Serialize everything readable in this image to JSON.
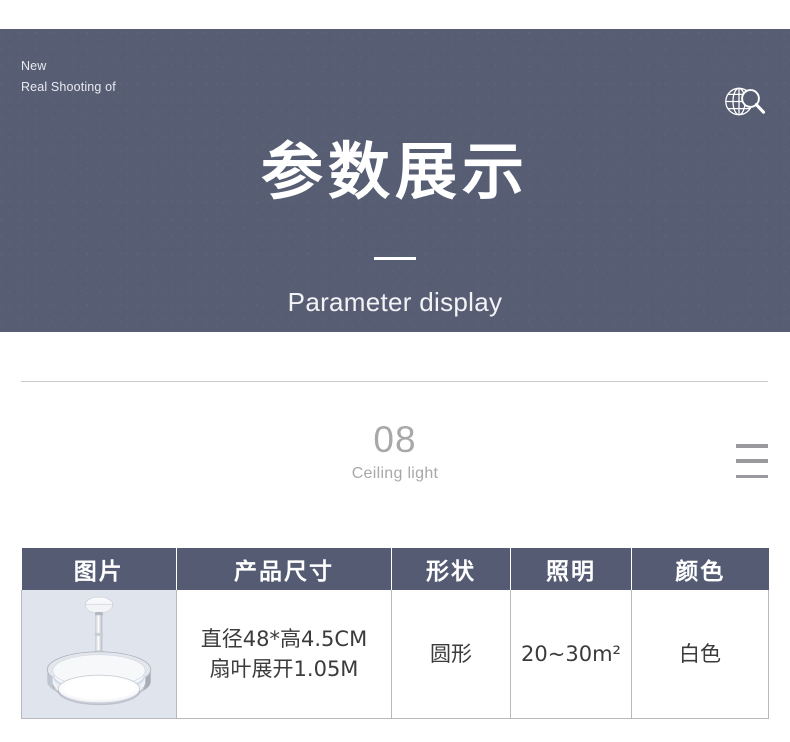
{
  "hero": {
    "corner_label": "New\nReal Shooting of",
    "title": "参数展示",
    "subtitle": "Parameter display",
    "bg_color": "#575e74",
    "icon": "globe-search-icon"
  },
  "section": {
    "number": "08",
    "name": "Ceiling light",
    "menu_icon": "hamburger-menu-icon"
  },
  "table": {
    "headers": [
      "图片",
      "产品尺寸",
      "形状",
      "照明",
      "颜色"
    ],
    "rows": [
      {
        "photo_alt": "ceiling-fan-light",
        "size": "直径48*高4.5CM\n扇叶展开1.05M",
        "shape": "圆形",
        "lighting": "20~30m²",
        "color": "白色"
      }
    ],
    "header_bg": "#545b72",
    "photo_cell_bg": "#dfe4ed",
    "border_color": "#b9b9bd"
  }
}
